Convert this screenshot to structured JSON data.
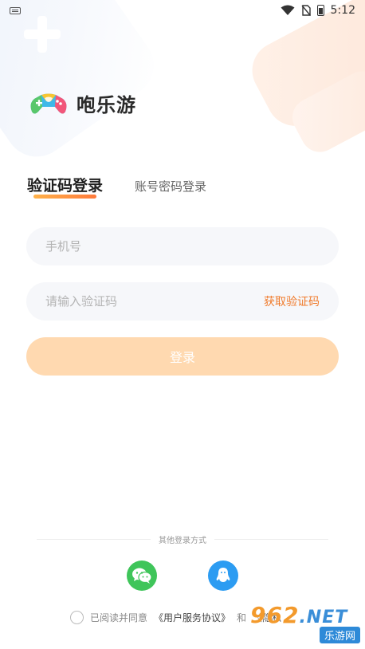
{
  "status_bar": {
    "time": "5:12"
  },
  "logo": {
    "text": "咆乐游"
  },
  "tabs": [
    {
      "label": "验证码登录",
      "active": true
    },
    {
      "label": "账号密码登录",
      "active": false
    }
  ],
  "phone": {
    "placeholder": "手机号",
    "value": ""
  },
  "code": {
    "placeholder": "请输入验证码",
    "value": "",
    "get_code_label": "获取验证码"
  },
  "login_button": "登录",
  "other_login": {
    "label": "其他登录方式",
    "options": [
      "wechat-icon",
      "qq-icon"
    ]
  },
  "agreement": {
    "prefix": "已阅读并同意",
    "user_agreement": "《用户服务协议》",
    "and": "和",
    "privacy": "《隐私"
  },
  "watermark": {
    "brand": "962",
    "domain": ".NET",
    "sub": "乐游网"
  },
  "colors": {
    "accent": "#f07a2a",
    "login_button_bg": "#ffd9b0",
    "wechat": "#3fc55a",
    "qq": "#2c9cf2"
  }
}
